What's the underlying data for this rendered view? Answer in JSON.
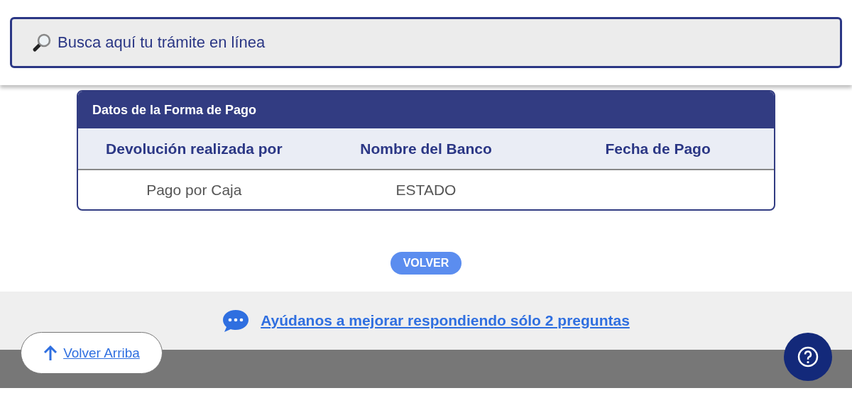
{
  "search": {
    "placeholder": "Busca aquí tu trámite en línea"
  },
  "payment_table": {
    "title": "Datos de la Forma de Pago",
    "columns": [
      "Devolución realizada por",
      "Nombre del Banco",
      "Fecha de Pago"
    ],
    "rows": [
      [
        "Pago por Caja",
        "ESTADO",
        ""
      ]
    ]
  },
  "back_button": "VOLVER",
  "feedback_link": "Ayúdanos a mejorar respondiendo sólo 2 preguntas",
  "scroll_top_link": "Volver Arriba"
}
